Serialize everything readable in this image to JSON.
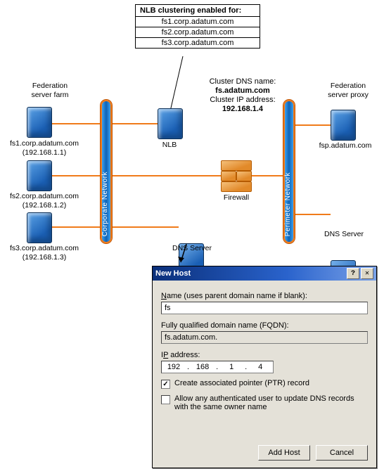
{
  "nlb": {
    "title": "NLB clustering enabled for:",
    "hosts": [
      "fs1.corp.adatum.com",
      "fs2.corp.adatum.com",
      "fs3.corp.adatum.com"
    ]
  },
  "cluster": {
    "dns_label": "Cluster DNS name:",
    "dns": "fs.adatum.com",
    "ip_label": "Cluster IP address:",
    "ip": "192.168.1.4"
  },
  "labels": {
    "farm": "Federation\nserver farm",
    "proxy": "Federation\nserver proxy",
    "nlb": "NLB",
    "firewall": "Firewall",
    "dns": "DNS Server",
    "corp_net": "Corporate Network",
    "perim_net": "Perimeter Network"
  },
  "servers": {
    "fs1": {
      "host": "fs1.corp.adatum.com",
      "ip": "(192.168.1.1)"
    },
    "fs2": {
      "host": "fs2.corp.adatum.com",
      "ip": "(192.168.1.2)"
    },
    "fs3": {
      "host": "fs3.corp.adatum.com",
      "ip": "(192.168.1.3)"
    },
    "fsp": {
      "host": "fsp.adatum.com"
    }
  },
  "dialog": {
    "title": "New Host",
    "name_label_pre": "N",
    "name_label_rest": "ame (uses parent domain name if blank):",
    "name_value": "fs",
    "fqdn_label": "Fully qualified domain name (FQDN):",
    "fqdn_value": "fs.adatum.com.",
    "ip_label_pre": "I",
    "ip_label_u": "P",
    "ip_label_rest": " address:",
    "ip": {
      "a": "192",
      "b": "168",
      "c": "1",
      "d": "4"
    },
    "chk_ptr_pre": "C",
    "chk_ptr_rest": "reate associated pointer (PTR) record",
    "chk_allow_pre": "Allow any authenticated user to update DNS records with the same ",
    "chk_allow_u": "o",
    "chk_allow_rest": "wner name",
    "btn_add_u": "H",
    "btn_add_pre": "Add ",
    "btn_add_rest": "ost",
    "btn_cancel": "Cancel",
    "help_glyph": "?",
    "close_glyph": "✕"
  }
}
